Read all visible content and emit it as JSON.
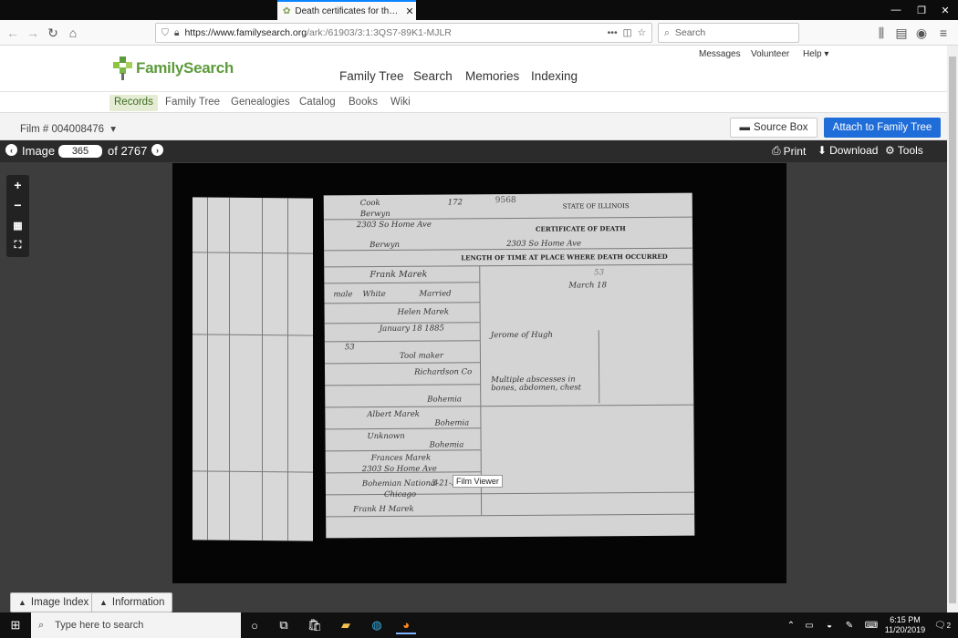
{
  "browser": {
    "tab_title": "Death certificates for the state",
    "url_host": "https://www.familysearch.org",
    "url_path": "/ark:/61903/3:1:3QS7-89K1-MJLR",
    "search_placeholder": "Search",
    "url_menu": "•••"
  },
  "site": {
    "logo_text": "FamilySearch",
    "util_links": [
      "Messages",
      "Volunteer",
      "Help"
    ],
    "main_nav": [
      "Family Tree",
      "Search",
      "Memories",
      "Indexing"
    ],
    "sub_nav": [
      "Records",
      "Family Tree",
      "Genealogies",
      "Catalog",
      "Books",
      "Wiki"
    ],
    "active_sub": "Records"
  },
  "film": {
    "label": "Film # 004008476",
    "source_box": "Source Box",
    "attach": "Attach to Family Tree"
  },
  "viewer": {
    "image_label": "Image",
    "image_number": "365",
    "image_total": "of 2767",
    "print": "Print",
    "download": "Download",
    "tools": "Tools",
    "tooltip": "Film Viewer",
    "image_index": "Image Index",
    "information": "Information"
  },
  "document": {
    "state_header": "STATE OF ILLINOIS",
    "cert_title": "CERTIFICATE OF DEATH",
    "length_title": "LENGTH OF TIME AT PLACE WHERE DEATH OCCURRED",
    "cert_number": "9568",
    "registered_no": "172",
    "county": "Cook",
    "city": "Berwyn",
    "address": "2303 So Home Ave",
    "full_name": "Frank Marek",
    "sex": "male",
    "color": "White",
    "marital": "Married",
    "spouse": "Helen Marek",
    "birth_date": "January 18 1885",
    "age": "53",
    "occupation": "Tool maker",
    "employer": "Richardson Co",
    "birthplace": "Bohemia",
    "father": "Albert Marek",
    "father_birthplace": "Bohemia",
    "mother": "Unknown",
    "mother_birthplace": "Bohemia",
    "informant": "Frances Marek",
    "informant_address": "2303 So Home Ave",
    "burial": "Bohemian National",
    "burial_date": "3-21-38",
    "burial_place": "Chicago",
    "undertaker": "Frank H Marek",
    "cause": "Jerome of Hugh",
    "other_conditions": "Multiple abscesses in bones, abdomen, chest",
    "death_date": "March 18",
    "side_number": "53"
  },
  "taskbar": {
    "search_placeholder": "Type here to search",
    "time": "6:15 PM",
    "date": "11/20/2019",
    "notif_count": "2"
  }
}
